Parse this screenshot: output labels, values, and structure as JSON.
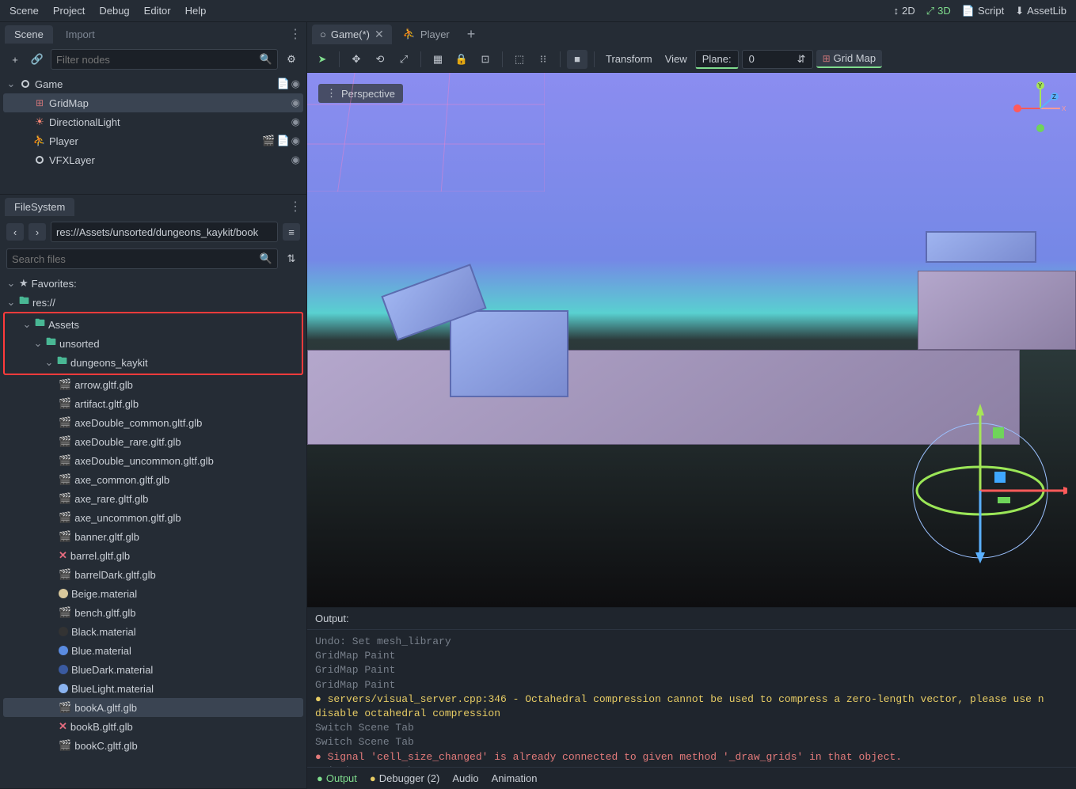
{
  "menu": {
    "scene": "Scene",
    "project": "Project",
    "debug": "Debug",
    "editor": "Editor",
    "help": "Help"
  },
  "topright": {
    "mode2d": "2D",
    "mode3d": "3D",
    "script": "Script",
    "assetlib": "AssetLib"
  },
  "scene_panel": {
    "tab_scene": "Scene",
    "tab_import": "Import",
    "filter_placeholder": "Filter nodes",
    "nodes": {
      "root": "Game",
      "gridmap": "GridMap",
      "light": "DirectionalLight",
      "player": "Player",
      "vfx": "VFXLayer"
    }
  },
  "filesystem": {
    "title": "FileSystem",
    "path": "res://Assets/unsorted/dungeons_kaykit/book",
    "search_placeholder": "Search files",
    "favorites": "Favorites:",
    "res": "res://",
    "folders": {
      "assets": "Assets",
      "unsorted": "unsorted",
      "dungeons": "dungeons_kaykit"
    },
    "files": [
      {
        "name": "arrow.gltf.glb",
        "icon": "scene"
      },
      {
        "name": "artifact.gltf.glb",
        "icon": "scene"
      },
      {
        "name": "axeDouble_common.gltf.glb",
        "icon": "scene"
      },
      {
        "name": "axeDouble_rare.gltf.glb",
        "icon": "scene"
      },
      {
        "name": "axeDouble_uncommon.gltf.glb",
        "icon": "scene"
      },
      {
        "name": "axe_common.gltf.glb",
        "icon": "scene"
      },
      {
        "name": "axe_rare.gltf.glb",
        "icon": "scene"
      },
      {
        "name": "axe_uncommon.gltf.glb",
        "icon": "scene"
      },
      {
        "name": "banner.gltf.glb",
        "icon": "scene"
      },
      {
        "name": "barrel.gltf.glb",
        "icon": "broken"
      },
      {
        "name": "barrelDark.gltf.glb",
        "icon": "scene"
      },
      {
        "name": "Beige.material",
        "icon": "mat-beige"
      },
      {
        "name": "bench.gltf.glb",
        "icon": "scene"
      },
      {
        "name": "Black.material",
        "icon": "mat-black"
      },
      {
        "name": "Blue.material",
        "icon": "mat-blue"
      },
      {
        "name": "BlueDark.material",
        "icon": "mat-blued"
      },
      {
        "name": "BlueLight.material",
        "icon": "mat-bluel"
      },
      {
        "name": "bookA.gltf.glb",
        "icon": "scene",
        "selected": true
      },
      {
        "name": "bookB.gltf.glb",
        "icon": "broken"
      },
      {
        "name": "bookC.gltf.glb",
        "icon": "scene"
      }
    ]
  },
  "editor_tabs": {
    "game": "Game(*)",
    "player": "Player"
  },
  "viewport": {
    "perspective": "Perspective",
    "transform": "Transform",
    "view": "View",
    "plane_label": "Plane:",
    "plane_value": "0",
    "gridmap_label": "Grid Map",
    "axis_y": "Y",
    "axis_z": "Z",
    "axis_x": "X"
  },
  "output": {
    "title": "Output:",
    "lines": [
      {
        "t": "Undo: Set mesh_library",
        "cls": "log-dim"
      },
      {
        "t": "GridMap Paint",
        "cls": "log-dim"
      },
      {
        "t": "GridMap Paint",
        "cls": "log-dim"
      },
      {
        "t": "GridMap Paint",
        "cls": "log-dim"
      },
      {
        "t": "servers/visual_server.cpp:346 - Octahedral compression cannot be used to compress a zero-length vector, please use n   disable octahedral compression",
        "cls": "log-warn"
      },
      {
        "t": "Switch Scene Tab",
        "cls": "log-dim"
      },
      {
        "t": "Switch Scene Tab",
        "cls": "log-dim"
      },
      {
        "t": "Signal 'cell_size_changed' is already connected to given method '_draw_grids' in that object.",
        "cls": "log-err"
      },
      {
        "t": "Switch Scene Tab",
        "cls": "log-dim"
      }
    ],
    "tabs": {
      "output": "Output",
      "debugger": "Debugger (2)",
      "audio": "Audio",
      "animation": "Animation"
    }
  }
}
